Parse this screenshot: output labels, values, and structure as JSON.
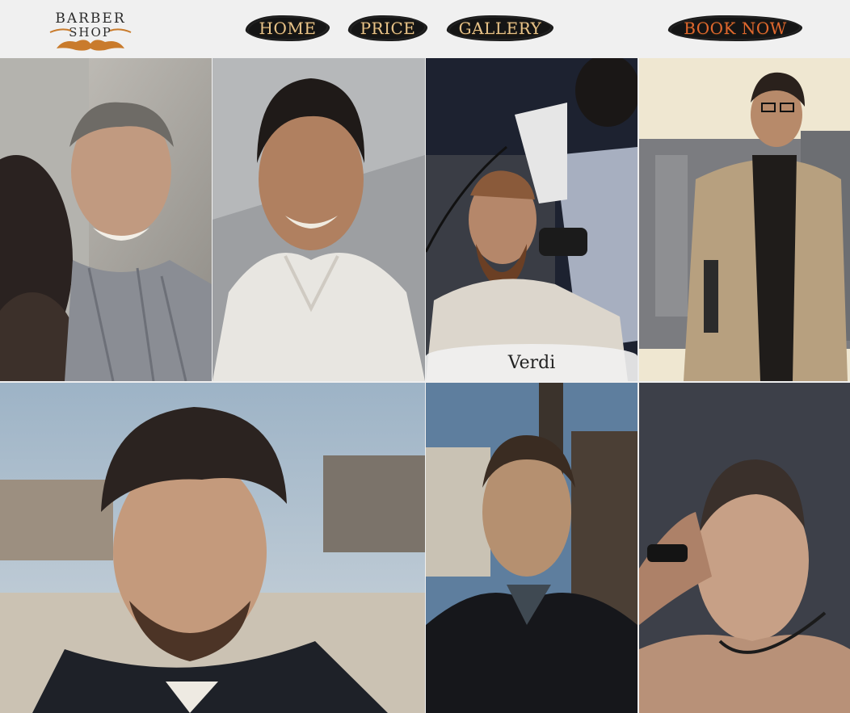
{
  "header": {
    "logo": {
      "line1": "BARBER",
      "line2": "SHOP"
    },
    "nav": [
      {
        "label": "HOME"
      },
      {
        "label": "PRICE"
      },
      {
        "label": "GALLERY"
      }
    ],
    "book_label": "BOOK NOW"
  },
  "gallery": {
    "caption": "Verdi",
    "colors": {
      "nav_text": "#e7c38a",
      "book_text": "#e0672f",
      "brush": "#151515",
      "background": "#f0f0f0"
    }
  }
}
